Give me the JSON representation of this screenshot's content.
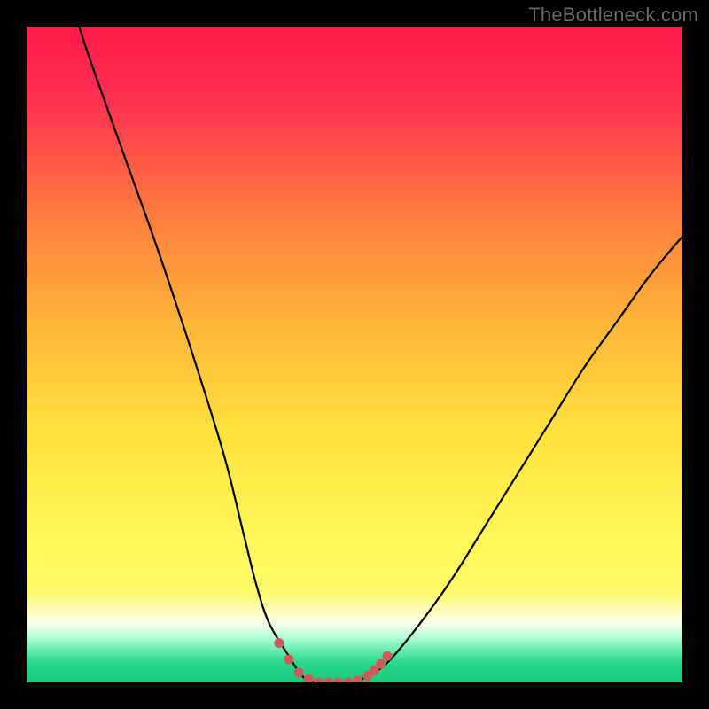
{
  "watermark": "TheBottleneck.com",
  "chart_data": {
    "type": "line",
    "title": "",
    "xlabel": "",
    "ylabel": "",
    "xlim": [
      0,
      100
    ],
    "ylim": [
      0,
      100
    ],
    "grid": false,
    "legend": false,
    "annotations": [],
    "series": [
      {
        "name": "bottleneck-curve",
        "x": [
          8,
          10,
          15,
          20,
          25,
          30,
          33,
          35,
          37,
          40,
          42,
          44,
          46,
          48,
          50,
          52,
          55,
          60,
          65,
          70,
          75,
          80,
          85,
          90,
          95,
          100
        ],
        "y": [
          100,
          94,
          80,
          66,
          51,
          35,
          23,
          15,
          9,
          4,
          1,
          0,
          0,
          0,
          0,
          1,
          3,
          9,
          16,
          24,
          32,
          40,
          48,
          55,
          62,
          68
        ],
        "color": "#000000"
      }
    ],
    "markers": {
      "name": "optimal-range-dots",
      "x": [
        38.5,
        40,
        41.5,
        43,
        44.5,
        46,
        47.5,
        49,
        50.5,
        52,
        53,
        54,
        55
      ],
      "y": [
        6,
        3.5,
        1.5,
        0.5,
        0,
        0,
        0,
        0,
        0.3,
        1,
        1.8,
        2.8,
        4
      ],
      "color": "#d05a5a",
      "size": 11
    },
    "background_gradient": {
      "stops": [
        {
          "pos": 0.0,
          "color": "#ff1a4b"
        },
        {
          "pos": 0.12,
          "color": "#ff3350"
        },
        {
          "pos": 0.28,
          "color": "#ff7a3e"
        },
        {
          "pos": 0.45,
          "color": "#ffb43a"
        },
        {
          "pos": 0.62,
          "color": "#ffe23e"
        },
        {
          "pos": 0.78,
          "color": "#fff858"
        },
        {
          "pos": 0.862,
          "color": "#fffa6a"
        },
        {
          "pos": 0.905,
          "color": "#fbffe0"
        },
        {
          "pos": 0.915,
          "color": "#eaffe8"
        },
        {
          "pos": 0.93,
          "color": "#b8ffd8"
        },
        {
          "pos": 0.94,
          "color": "#8ff6c6"
        },
        {
          "pos": 0.955,
          "color": "#5ae6a6"
        },
        {
          "pos": 0.97,
          "color": "#29d98d"
        },
        {
          "pos": 1.0,
          "color": "#17c97c"
        }
      ]
    }
  }
}
